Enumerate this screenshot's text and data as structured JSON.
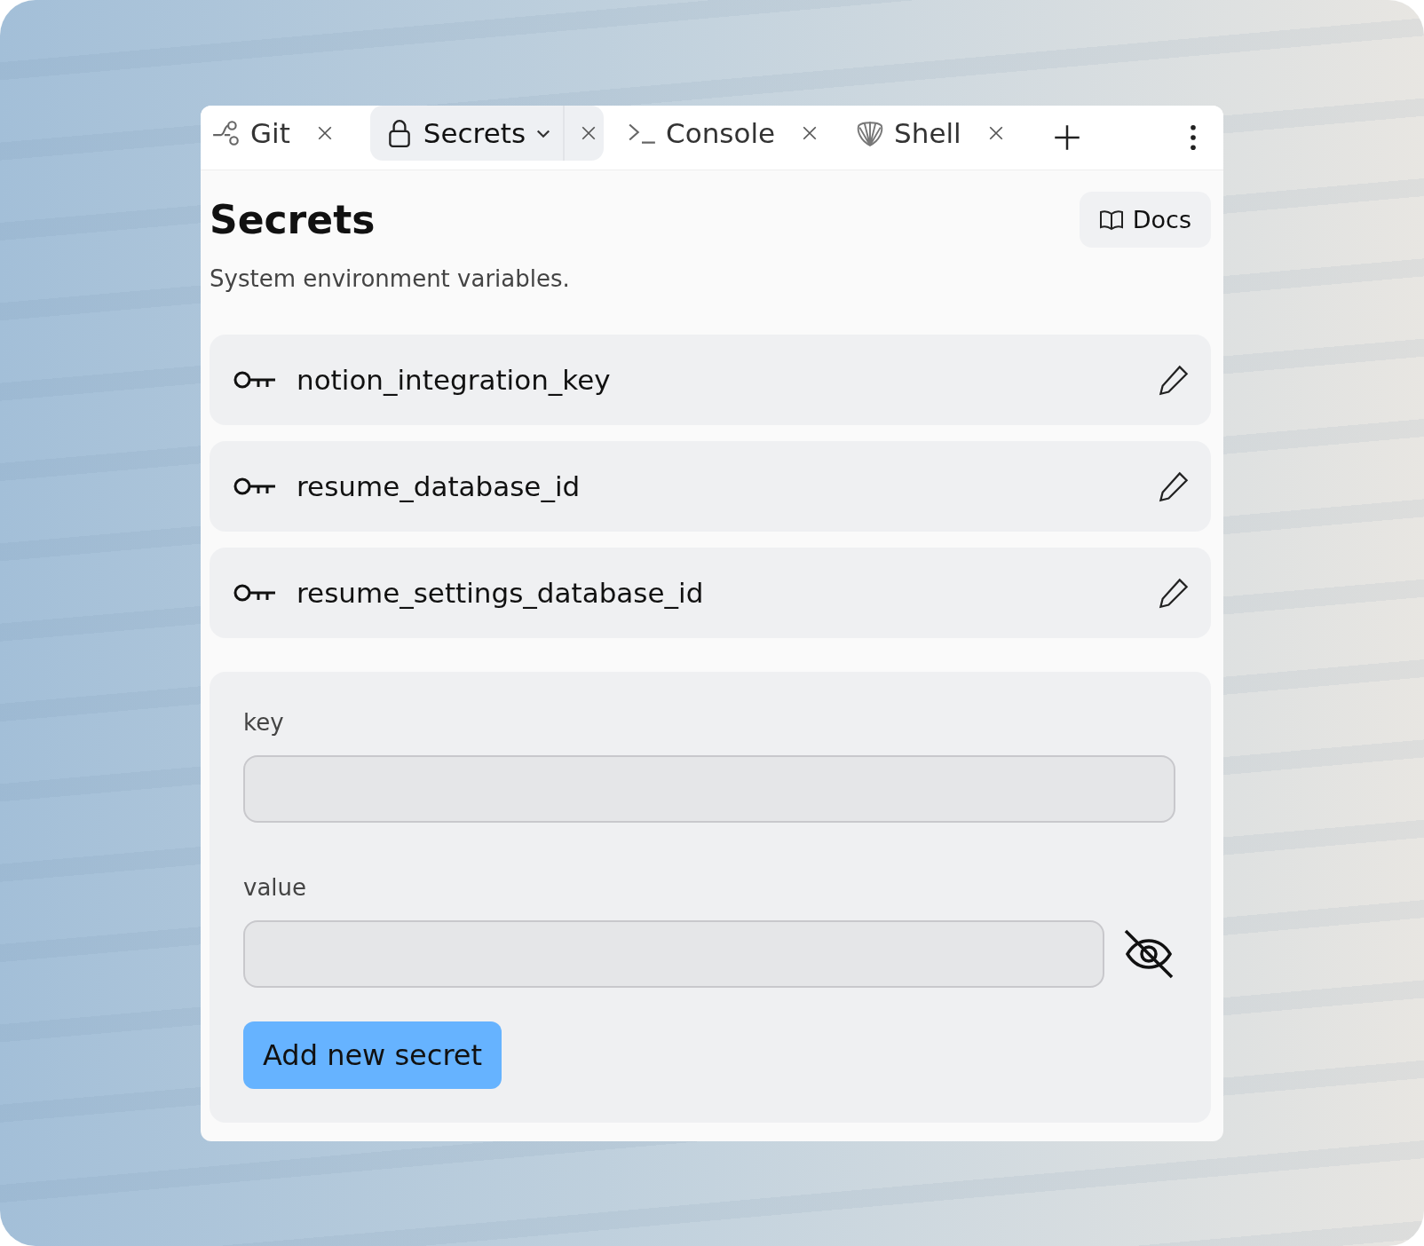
{
  "tabs": [
    {
      "label": "Git",
      "kind": "git",
      "selected": false,
      "menu": false
    },
    {
      "label": "Secrets",
      "kind": "lock",
      "selected": true,
      "menu": true
    },
    {
      "label": "Console",
      "kind": "console",
      "selected": false,
      "menu": false
    },
    {
      "label": "Shell",
      "kind": "shell",
      "selected": false,
      "menu": false
    }
  ],
  "heading": "Secrets",
  "docs_button": "Docs",
  "subtitle": "System environment variables.",
  "secrets": [
    {
      "name": "notion_integration_key"
    },
    {
      "name": "resume_database_id"
    },
    {
      "name": "resume_settings_database_id"
    }
  ],
  "form": {
    "key_label": "key",
    "value_label": "value",
    "value_hidden": true,
    "submit": "Add new secret"
  }
}
